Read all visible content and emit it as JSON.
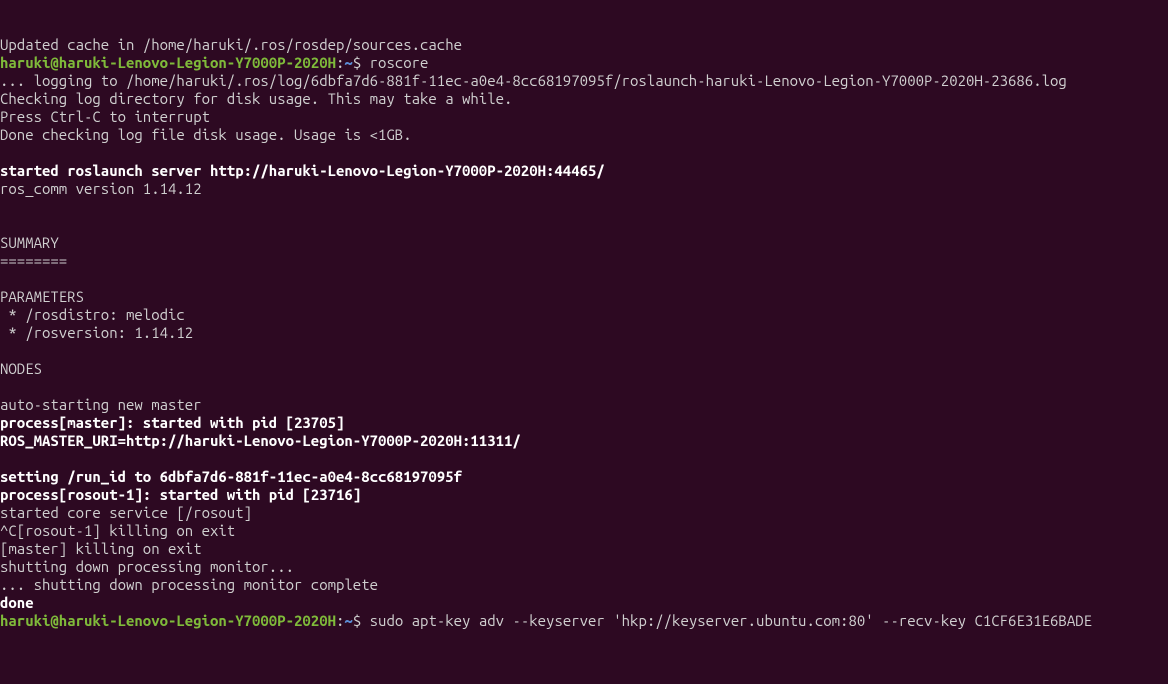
{
  "lines": {
    "l1": "Updated cache in /home/haruki/.ros/rosdep/sources.cache",
    "prompt_user": "haruki@haruki-Lenovo-Legion-Y7000P-2020H",
    "prompt_sep": ":",
    "prompt_path": "~",
    "prompt_end": "$ ",
    "cmd1": "roscore",
    "l3": "... logging to /home/haruki/.ros/log/6dbfa7d6-881f-11ec-a0e4-8cc68197095f/roslaunch-haruki-Lenovo-Legion-Y7000P-2020H-23686.log",
    "l4": "Checking log directory for disk usage. This may take a while.",
    "l5": "Press Ctrl-C to interrupt",
    "l6": "Done checking log file disk usage. Usage is <1GB.",
    "l7": "started roslaunch server http://haruki-Lenovo-Legion-Y7000P-2020H:44465/",
    "l8": "ros_comm version 1.14.12",
    "l9": "SUMMARY",
    "l10": "========",
    "l11": "PARAMETERS",
    "l12": " * /rosdistro: melodic",
    "l13": " * /rosversion: 1.14.12",
    "l14": "NODES",
    "l15": "auto-starting new master",
    "l16": "process[master]: started with pid [23705]",
    "l17": "ROS_MASTER_URI=http://haruki-Lenovo-Legion-Y7000P-2020H:11311/",
    "l18": "setting /run_id to 6dbfa7d6-881f-11ec-a0e4-8cc68197095f",
    "l19": "process[rosout-1]: started with pid [23716]",
    "l20": "started core service [/rosout]",
    "l21": "^C[rosout-1] killing on exit",
    "l22": "[master] killing on exit",
    "l23": "shutting down processing monitor...",
    "l24": "... shutting down processing monitor complete",
    "l25": "done",
    "cmd2": "sudo apt-key adv --keyserver 'hkp://keyserver.ubuntu.com:80' --recv-key C1CF6E31E6BADE"
  }
}
